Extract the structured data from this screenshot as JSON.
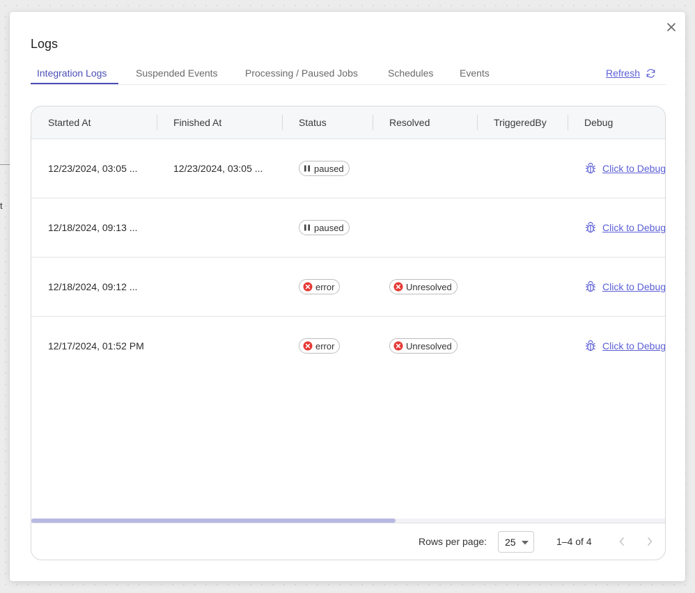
{
  "background": {
    "fragment_text": "t"
  },
  "dialog": {
    "title": "Logs",
    "close_icon": "close-icon",
    "tabs": [
      {
        "label": "Integration Logs",
        "active": true
      },
      {
        "label": "Suspended Events",
        "active": false
      },
      {
        "label": "Processing / Paused Jobs",
        "active": false
      },
      {
        "label": "Schedules",
        "active": false
      },
      {
        "label": "Events",
        "active": false
      }
    ],
    "refresh": {
      "label": "Refresh",
      "icon": "refresh-icon"
    }
  },
  "table": {
    "columns": [
      "Started At",
      "Finished At",
      "Status",
      "Resolved",
      "TriggeredBy",
      "Debug"
    ],
    "rows": [
      {
        "started_at": "12/23/2024, 03:05 ...",
        "finished_at": "12/23/2024, 03:05 ...",
        "status": "paused",
        "resolved": "",
        "triggered_by": "",
        "debug": "Click to Debug"
      },
      {
        "started_at": "12/18/2024, 09:13 ...",
        "finished_at": "",
        "status": "paused",
        "resolved": "",
        "triggered_by": "",
        "debug": "Click to Debug"
      },
      {
        "started_at": "12/18/2024, 09:12 ...",
        "finished_at": "",
        "status": "error",
        "resolved": "Unresolved",
        "triggered_by": "",
        "debug": "Click to Debug"
      },
      {
        "started_at": "12/17/2024, 01:52 PM",
        "finished_at": "",
        "status": "error",
        "resolved": "Unresolved",
        "triggered_by": "",
        "debug": "Click to Debug"
      }
    ],
    "horizontal_scroll_position": 0,
    "horizontal_scroll_visible_fraction": 0.575
  },
  "pagination": {
    "rows_per_page_label": "Rows per page:",
    "rows_per_page_value": "25",
    "range_text": "1–4 of 4",
    "prev_icon": "chevron-left-icon",
    "next_icon": "chevron-right-icon"
  },
  "colors": {
    "accent": "#4b4fb6",
    "link": "#5a5ed6",
    "error": "#e53935",
    "scroll_thumb": "#b8b8e2"
  }
}
